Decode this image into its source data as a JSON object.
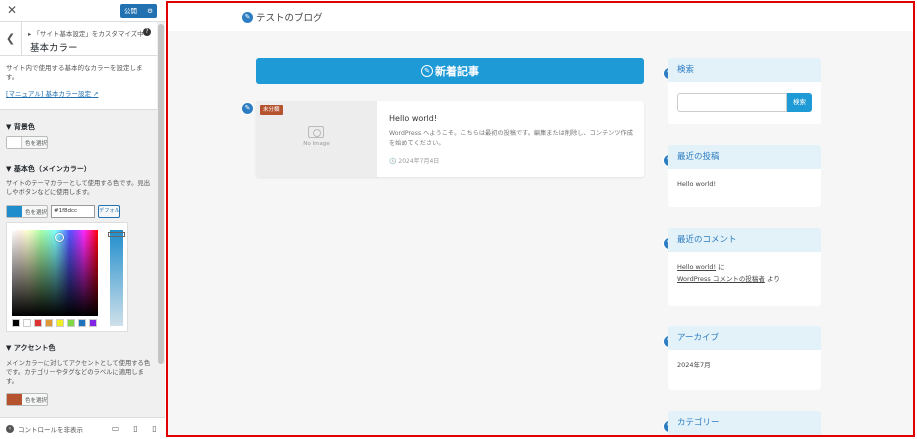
{
  "customizer": {
    "publish_label": "公開",
    "breadcrumb": "「サイト基本設定」をカスタマイズ中",
    "section_title": "基本カラー",
    "description": "サイト内で使用する基本的なカラーを設定します。",
    "manual_link": "[マニュアル] 基本カラー設定",
    "background_label": "▼ 背景色",
    "select_color": "色を選択",
    "main_color_label": "▼ 基本色（メインカラー）",
    "main_color_desc": "サイトのテーマカラーとして使用する色です。見出しやボタンなどに使用します。",
    "main_hex": "#1f8dcc",
    "default_label": "デフォルト",
    "accent_label": "▼ アクセント色",
    "accent_desc": "メインカラーに対してアクセントとして使用する色です。カテゴリーやタグなどのラベルに適用します。",
    "hide_controls": "コントロールを非表示",
    "colors": {
      "main": "#1f8dcc",
      "accent": "#b5532f",
      "palettes": [
        "#000000",
        "#ffffff",
        "#dd3333",
        "#dd9933",
        "#eeee22",
        "#81d742",
        "#1e73be",
        "#8224e3"
      ]
    }
  },
  "preview": {
    "site_title": "テストのブログ",
    "main_heading": "新着記事",
    "post": {
      "category": "未分類",
      "noimage": "No Image",
      "title": "Hello world!",
      "excerpt": "WordPress へようこそ。こちらは最初の投稿です。編集または削除し、コンテンツ作成を始めてください。",
      "date": "2024年7月4日"
    },
    "widgets": {
      "search": {
        "title": "検索",
        "button": "検索"
      },
      "recent_posts": {
        "title": "最近の投稿",
        "item": "Hello world!"
      },
      "recent_comments": {
        "title": "最近のコメント",
        "post_link": "Hello world!",
        "connector": " に",
        "author_link": "WordPress コメントの投稿者",
        "suffix": " より"
      },
      "archives": {
        "title": "アーカイブ",
        "item": "2024年7月"
      },
      "categories": {
        "title": "カテゴリー"
      }
    }
  }
}
